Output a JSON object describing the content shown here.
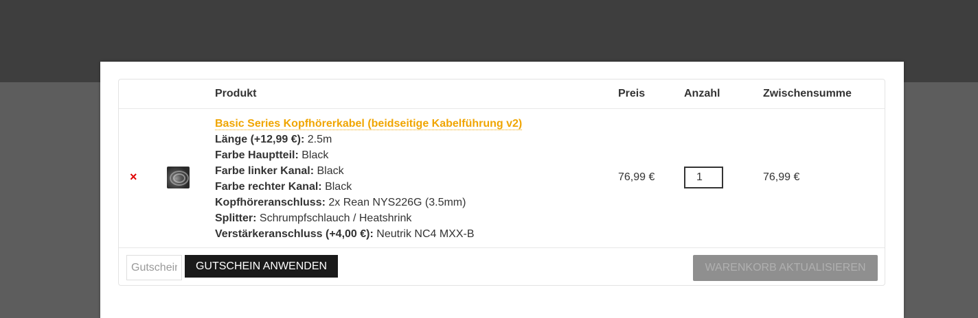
{
  "cart": {
    "headers": {
      "product": "Produkt",
      "price": "Preis",
      "quantity": "Anzahl",
      "subtotal": "Zwischensumme"
    },
    "item": {
      "remove_symbol": "×",
      "title": "Basic Series Kopfhörerkabel (beidseitige Kabelführung v2)",
      "meta": [
        {
          "key": "Länge (+12,99 €):",
          "value": "2.5m"
        },
        {
          "key": "Farbe Hauptteil:",
          "value": "Black"
        },
        {
          "key": "Farbe linker Kanal:",
          "value": "Black"
        },
        {
          "key": "Farbe rechter Kanal:",
          "value": "Black"
        },
        {
          "key": "Kopfhöreranschluss:",
          "value": "2x Rean NYS226G (3.5mm)"
        },
        {
          "key": "Splitter:",
          "value": "Schrumpfschlauch / Heatshrink"
        },
        {
          "key": "Verstärkeranschluss (+4,00 €):",
          "value": "Neutrik NC4 MXX-B"
        }
      ],
      "price": "76,99 €",
      "quantity": "1",
      "subtotal": "76,99 €"
    },
    "actions": {
      "coupon_placeholder": "Gutschein",
      "coupon_button": "GUTSCHEIN ANWENDEN",
      "update_button": "WARENKORB AKTUALISIEREN"
    }
  },
  "colors": {
    "link": "#f0a500",
    "remove": "#e00000",
    "dark_button": "#1a1a1a",
    "disabled_button": "#8f8f8f"
  }
}
